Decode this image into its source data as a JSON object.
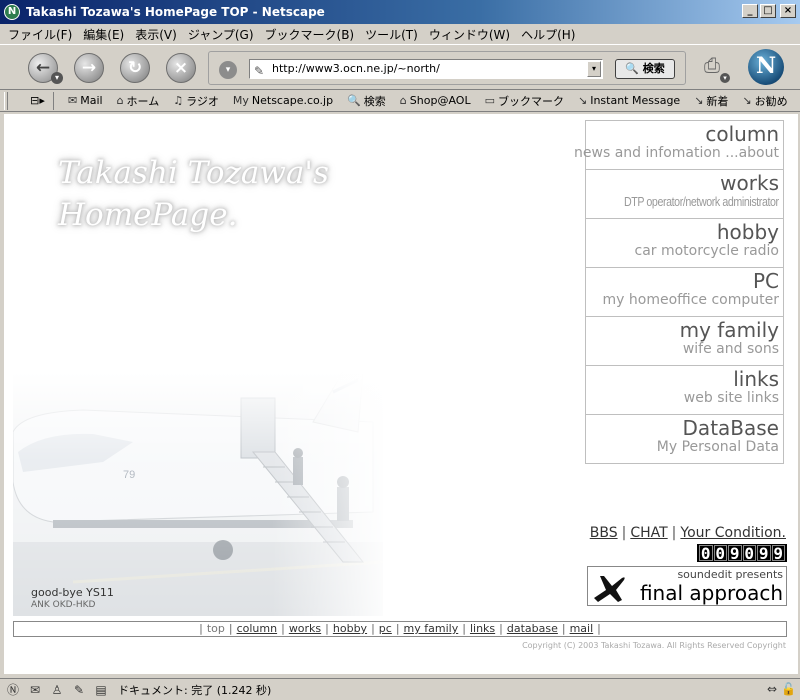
{
  "window": {
    "title": "Takashi Tozawa's HomePage TOP - Netscape",
    "buttons": {
      "minimize": "_",
      "maximize": "□",
      "close": "×"
    }
  },
  "menubar": [
    "ファイル(F)",
    "編集(E)",
    "表示(V)",
    "ジャンプ(G)",
    "ブックマーク(B)",
    "ツール(T)",
    "ウィンドウ(W)",
    "ヘルプ(H)"
  ],
  "toolbar": {
    "url": "http://www3.ocn.ne.jp/~north/",
    "search_label": "🔍 検索"
  },
  "personal_toolbar": [
    {
      "icon": "✉",
      "label": "Mail"
    },
    {
      "icon": "⌂",
      "label": "ホーム"
    },
    {
      "icon": "♫",
      "label": "ラジオ"
    },
    {
      "icon": "My",
      "label": "Netscape.co.jp"
    },
    {
      "icon": "🔍",
      "label": "検索"
    },
    {
      "icon": "⌂",
      "label": "Shop@AOL"
    },
    {
      "icon": "▭",
      "label": "ブックマーク"
    },
    {
      "icon": "↘",
      "label": "Instant Message"
    },
    {
      "icon": "↘",
      "label": "新着"
    },
    {
      "icon": "↘",
      "label": "お勧め"
    }
  ],
  "page": {
    "hero_line1": "Takashi Tozawa's",
    "hero_line2": "HomePage.",
    "photo_caption": "good-bye YS11",
    "photo_subcaption": "ANK OKD-HKD",
    "menu": [
      {
        "title": "column",
        "sub": "news and infomation ...about"
      },
      {
        "title": "works",
        "sub": "DTP operator/network administrator"
      },
      {
        "title": "hobby",
        "sub": "car motorcycle radio"
      },
      {
        "title": "PC",
        "sub": "my homeoffice computer"
      },
      {
        "title": "my family",
        "sub": "wife and sons"
      },
      {
        "title": "links",
        "sub": "web site links"
      },
      {
        "title": "DataBase",
        "sub": "My Personal Data"
      }
    ],
    "top_links": [
      "BBS",
      "CHAT",
      "Your Condition."
    ],
    "counter_digits": [
      "0",
      "0",
      "9",
      "0",
      "9",
      "9"
    ],
    "banner_presents": "soundedit presents",
    "banner_title": "final approach",
    "footer_nav": [
      "top",
      "column",
      "works",
      "hobby",
      "pc",
      "my family",
      "links",
      "database",
      "mail"
    ],
    "copyright": "Copyright (C) 2003 Takashi Tozawa. All Rights Reserved Copyright"
  },
  "statusbar": {
    "text": "ドキュメント: 完了 (1.242 秒)"
  }
}
